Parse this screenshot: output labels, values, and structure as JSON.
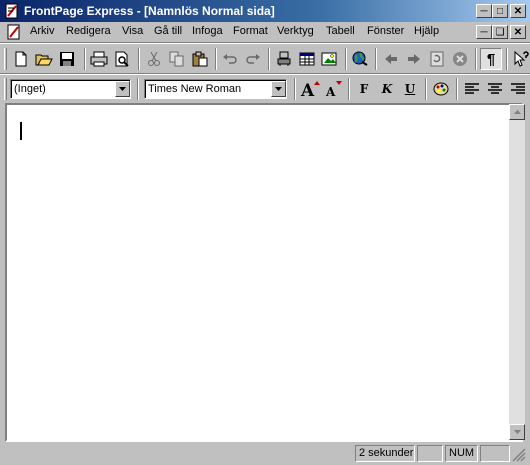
{
  "window": {
    "title": "FrontPage Express - [Namnlös Normal sida]"
  },
  "menu": {
    "items": [
      "Arkiv",
      "Redigera",
      "Visa",
      "Gå till",
      "Infoga",
      "Format",
      "Verktyg",
      "Tabell",
      "Fönster",
      "Hjälp"
    ]
  },
  "format_toolbar": {
    "style_value": "(Inget)",
    "font_value": "Times New Roman",
    "bold_label": "F",
    "italic_label": "K",
    "underline_label": "U"
  },
  "statusbar": {
    "timing": "2 sekunder",
    "num": "NUM"
  },
  "colors": {
    "title_start": "#0a246a",
    "title_end": "#a6caf0",
    "face": "#c0c0c0"
  }
}
